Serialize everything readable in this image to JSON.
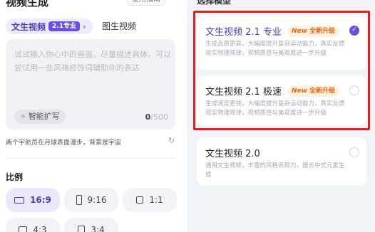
{
  "left": {
    "title": "视频生成",
    "top_link": "使用指南",
    "tabs": {
      "active": {
        "label": "文生视频",
        "badge": "2.1专业",
        "chevron": "›"
      },
      "inactive": {
        "label": "图生视频"
      }
    },
    "prompt": {
      "placeholder": "试试输入你心中的画面，尽量描述具体，可以尝试用一些风格修饰词辅助你的表达",
      "assist_label": "智能扩写",
      "counter_current": "0",
      "counter_max": "/500"
    },
    "example": "两个宇航员在月球表面漫步，背景是宇宙",
    "ratio": {
      "title": "比例",
      "options": [
        {
          "label": "16:9",
          "selected": true
        },
        {
          "label": "9:16",
          "selected": false
        },
        {
          "label": "1:1",
          "selected": false
        },
        {
          "label": "4:3",
          "selected": false
        },
        {
          "label": "3:4",
          "selected": false
        }
      ]
    }
  },
  "right": {
    "title": "选择模型",
    "models": [
      {
        "name": "文生视频 2.1 专业",
        "badge_new": "New",
        "badge_text": "全新升级",
        "desc": "生成品质更高，大幅度提升复杂运动能力，真实反馈现实物理规律，视频质感与美观度进一步升级",
        "selected": true
      },
      {
        "name": "文生视频 2.1 极速",
        "badge_new": "New",
        "badge_text": "全新升级",
        "desc": "生成速度更快，大幅度提升复杂运动能力，真实反馈现实物理规律，视频质感与美观度进一步升级",
        "selected": false
      },
      {
        "name": "文生视频 2.0",
        "desc": "通用文生视频，丰富的风格表现力，擅长中式元素生成",
        "selected": false
      }
    ]
  },
  "colors": {
    "accent": "#6a4fe0",
    "highlight": "#e02020",
    "badge_orange": "#e86a10"
  },
  "icons": {
    "assist": "magic-wand-icon",
    "refresh": "refresh-icon",
    "check": "check-icon"
  }
}
